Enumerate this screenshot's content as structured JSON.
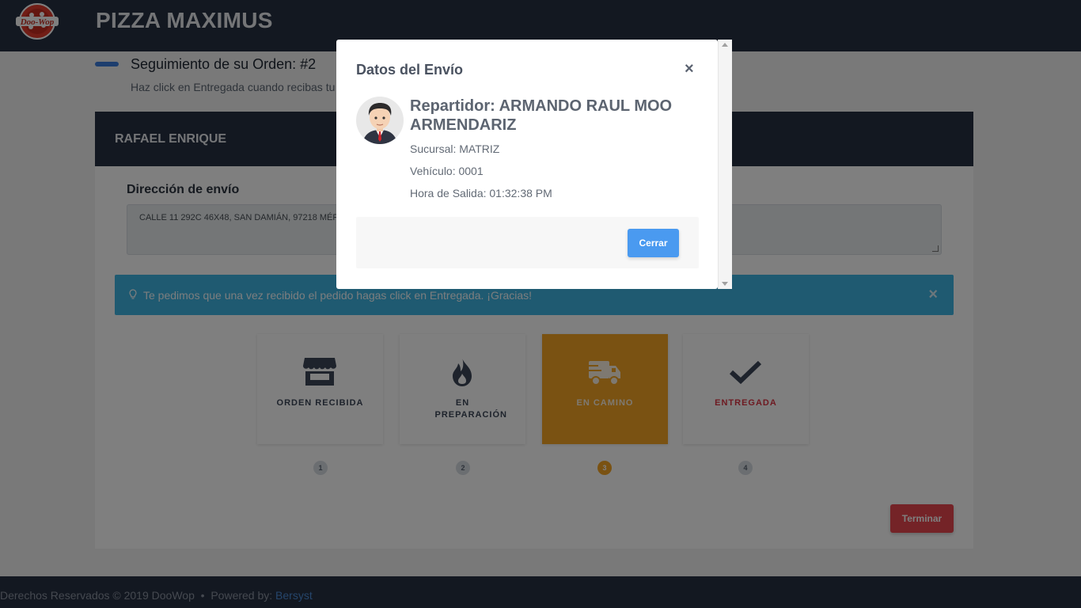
{
  "app": {
    "brand": "PIZZA MAXIMUS",
    "logo_text": "Doo-Wop"
  },
  "page": {
    "title": "Seguimiento de su Orden: #2",
    "subtitle": "Haz click en Entregada cuando recibas tu pedido."
  },
  "card": {
    "customer_name": "RAFAEL ENRIQUE",
    "address_label": "Dirección de envío",
    "address_value": "CALLE 11 292C 46X48, SAN DAMIÁN, 97218 MÉRIDA, YUC."
  },
  "alert": {
    "text": "Te pedimos que una vez recibido el pedido hagas click en Entregada. ¡Gracias!",
    "close": "×",
    "color": "#3fb5e3"
  },
  "steps": [
    {
      "label": "ORDEN RECIBIDA",
      "number": "1",
      "icon": "store-icon"
    },
    {
      "label": "EN PREPARACIÓN",
      "number": "2",
      "icon": "fire-icon"
    },
    {
      "label": "EN CAMINO",
      "number": "3",
      "icon": "truck-icon",
      "active": true
    },
    {
      "label": "ENTREGADA",
      "number": "4",
      "icon": "check-icon"
    }
  ],
  "actions": {
    "finish": "Terminar"
  },
  "footer": {
    "copyright": "Derechos Reservados © 2019 DooWop",
    "separator": "•",
    "powered_by": "Powered by:",
    "powered_link": "Bersyst"
  },
  "modal": {
    "title": "Datos del Envío",
    "close": "×",
    "driver": "Repartidor: ARMANDO RAUL MOO ARMENDARIZ",
    "branch": "Sucursal: MATRIZ",
    "vehicle": "Vehículo: 0001",
    "departure": "Hora de Salida: 01:32:38 PM",
    "close_button": "Cerrar"
  },
  "colors": {
    "dark": "#273043",
    "accent": "#f4a524",
    "primary": "#4a9af0",
    "danger": "#e8464f"
  }
}
